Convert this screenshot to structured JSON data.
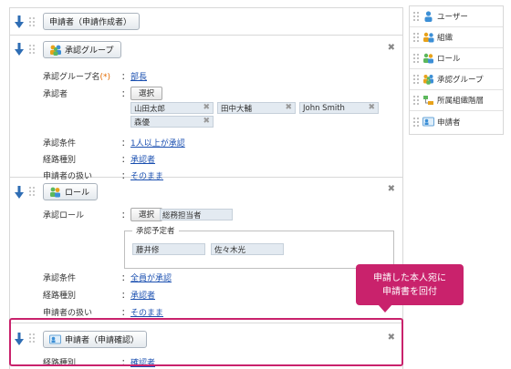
{
  "blocks": {
    "applicant": {
      "title": "申請者（申請作成者）"
    },
    "approval_group": {
      "title": "承認グループ",
      "group_name_label": "承認グループ名",
      "required_mark": "(*)",
      "group_name_value": "部長",
      "approvers_label": "承認者",
      "select_label": "選択",
      "approvers": [
        "山田太郎",
        "田中大輔",
        "John Smith",
        "森優"
      ],
      "condition_label": "承認条件",
      "condition_value": "1人以上が承認",
      "route_label": "経路種別",
      "route_value": "承認者",
      "handling_label": "申請者の扱い",
      "handling_value": "そのまま"
    },
    "role": {
      "title": "ロール",
      "role_label": "承認ロール",
      "select_label": "選択",
      "role_value": "総務担当者",
      "planned_legend": "承認予定者",
      "planned": [
        "藤井修",
        "佐々木光"
      ],
      "condition_label": "承認条件",
      "condition_value": "全員が承認",
      "route_label": "経路種別",
      "route_value": "承認者",
      "handling_label": "申請者の扱い",
      "handling_value": "そのまま"
    },
    "applicant_confirm": {
      "title": "申請者（申請確認）",
      "route_label": "経路種別",
      "route_value": "確認者"
    }
  },
  "colon": "：",
  "close_symbol": "✖",
  "chip_remove": "✖",
  "palette": {
    "items": [
      "ユーザー",
      "組織",
      "ロール",
      "承認グループ",
      "所属組織階層",
      "申請者"
    ]
  },
  "callout": {
    "line1": "申請した本人宛に",
    "line2": "申請書を回付"
  },
  "colors": {
    "accent": "#c9226c",
    "arrow": "#2e6db4",
    "link": "#1a4fb0",
    "required": "#e26a00"
  },
  "icons": [
    "arrow-down-icon",
    "drag-handle-icon",
    "group-icon",
    "role-icon",
    "applicant-icon",
    "close-icon",
    "user-icon",
    "organization-icon",
    "hierarchy-icon"
  ]
}
